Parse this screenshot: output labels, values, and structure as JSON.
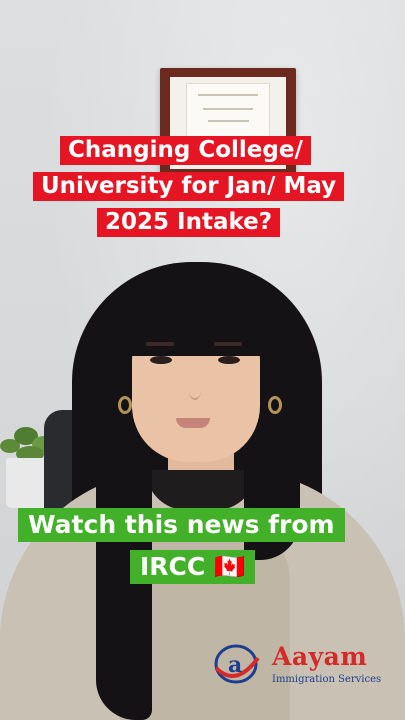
{
  "captions": {
    "top_line1": "Changing College/",
    "top_line2": "University for Jan/ May",
    "top_line3": "2025 Intake?",
    "bottom_line1": "Watch this news from",
    "bottom_line2": "IRCC 🇨🇦"
  },
  "logo": {
    "name": "Aayam",
    "subtitle": "Immigration Services"
  },
  "colors": {
    "caption_red": "#e61523",
    "caption_green": "#43b02a",
    "logo_red": "#d42a2a",
    "logo_blue": "#1e3f8f"
  }
}
